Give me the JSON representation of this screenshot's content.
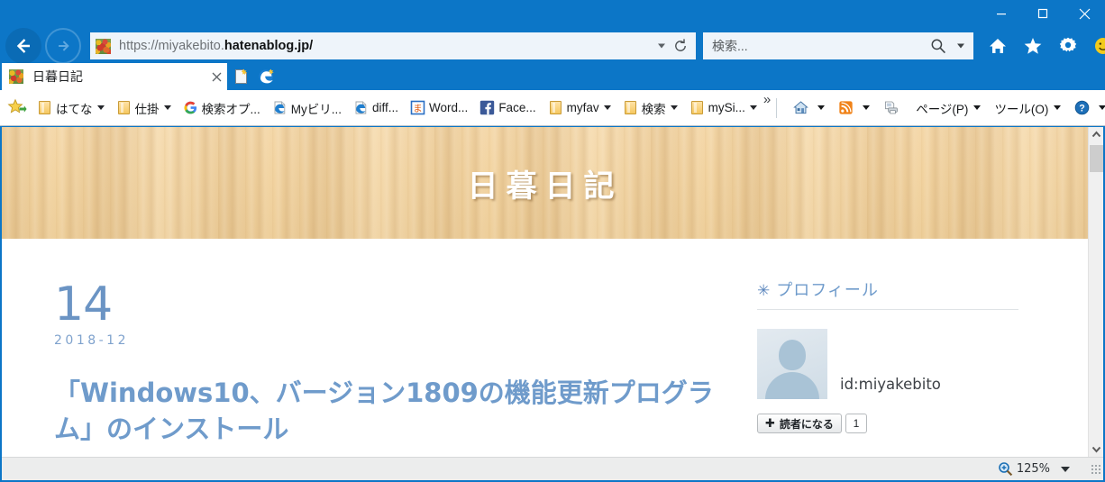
{
  "window": {
    "minimize_label": "Minimize",
    "maximize_label": "Maximize",
    "close_label": "Close"
  },
  "navigation": {
    "back_label": "Back",
    "forward_label": "Forward",
    "address_prefix": "https://miyakebito.",
    "address_domain": "hatenablog.jp/",
    "refresh_label": "Refresh",
    "search_placeholder": "検索...",
    "home_label": "Home",
    "favorites_label": "Favorites",
    "settings_label": "Tools",
    "feedback_label": "Feedback"
  },
  "tabs": [
    {
      "title": "日暮日記",
      "close_label": "×"
    }
  ],
  "tab_controls": {
    "new_tab_label": "New tab",
    "edge_label": "Open with Microsoft Edge"
  },
  "favorites_bar": {
    "items": [
      {
        "label": "はてな",
        "icon": "folder-icon",
        "has_arrow": true
      },
      {
        "label": "仕掛",
        "icon": "folder-icon",
        "has_arrow": true
      },
      {
        "label": "検索オプ...",
        "icon": "google-icon",
        "has_arrow": false
      },
      {
        "label": "Myビリ...",
        "icon": "ie-icon",
        "has_arrow": false
      },
      {
        "label": "diff...",
        "icon": "ie-icon",
        "has_arrow": false
      },
      {
        "label": "Word...",
        "icon": "weblio-icon",
        "has_arrow": false
      },
      {
        "label": "Face...",
        "icon": "facebook-icon",
        "has_arrow": false
      },
      {
        "label": "myfav",
        "icon": "folder-icon",
        "has_arrow": true
      },
      {
        "label": "検索",
        "icon": "folder-icon",
        "has_arrow": true
      },
      {
        "label": "mySi...",
        "icon": "folder-icon",
        "has_arrow": true
      }
    ],
    "overflow_label": "»"
  },
  "command_bar": {
    "home_label": "Home",
    "feeds_label": "Feeds",
    "print_label": "Print",
    "page_label": "ページ(P)",
    "page_accel": "P",
    "tools_label": "ツール(O)",
    "tools_accel": "O",
    "help_label": "Help"
  },
  "page": {
    "banner_title": "日暮日記",
    "entry": {
      "day": "14",
      "year_month": "2018-12",
      "title": "「Windows10、バージョン1809の機能更新プログラム」のインストール"
    },
    "sidebar": {
      "profile_heading": "プロフィール",
      "profile_heading_marker": "✳",
      "user_id": "id:miyakebito",
      "subscribe_label": "読者になる",
      "subscribe_plus": "✚",
      "subscriber_count": "1"
    }
  },
  "status_bar": {
    "zoom_level": "125%",
    "zoom_icon": "zoom-in-icon"
  },
  "colors": {
    "chrome_blue": "#0c76c7",
    "banner_wood": "#f3d5a3",
    "accent_blue": "#6f9bcb",
    "link_blue": "#6b94c4"
  }
}
